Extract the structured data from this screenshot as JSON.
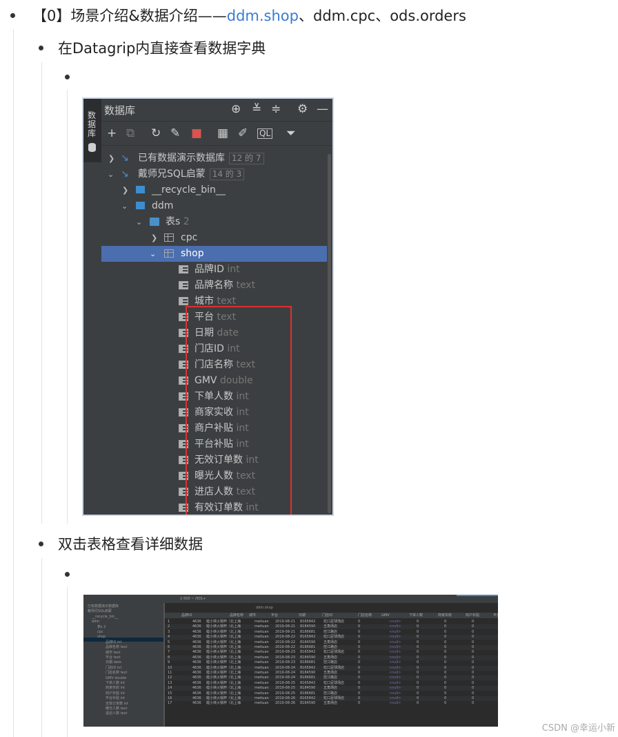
{
  "line1": {
    "prefix": "【0】场景介绍&数据介绍——",
    "link": "ddm.shop",
    "suffix": "、ddm.cpc、ods.orders"
  },
  "line2": "在Datagrip内直接查看数据字典",
  "line3": "双击表格查看详细数据",
  "watermark": "CSDN @幸运小新",
  "db_panel": {
    "side_tab": "数据库",
    "title": "数据库",
    "title_icons": [
      "crosshair-icon",
      "expand-all-icon",
      "collapse-all-icon",
      "gear-icon",
      "minimize-icon"
    ],
    "toolbar_icons": [
      "add-icon",
      "copy-icon",
      "refresh-icon",
      "edit-schema-icon",
      "stop-icon",
      "table-icon",
      "edit-icon",
      "sql-icon",
      "filter-icon"
    ],
    "tree": {
      "ds1": {
        "label": "已有数据演示数据库",
        "badge": "12 的 7"
      },
      "ds2": {
        "label": "戴师兄SQL启蒙",
        "badge": "14 的 3"
      },
      "recycle": "__recycle_bin__",
      "ddm": "ddm",
      "tables_folder": "表s",
      "tables_count": "2",
      "cpc": "cpc",
      "shop": "shop"
    },
    "columns": [
      {
        "name": "品牌ID",
        "type": "int"
      },
      {
        "name": "品牌名称",
        "type": "text"
      },
      {
        "name": "城市",
        "type": "text"
      },
      {
        "name": "平台",
        "type": "text"
      },
      {
        "name": "日期",
        "type": "date"
      },
      {
        "name": "门店ID",
        "type": "int"
      },
      {
        "name": "门店名称",
        "type": "text"
      },
      {
        "name": "GMV",
        "type": "double"
      },
      {
        "name": "下单人数",
        "type": "int"
      },
      {
        "name": "商家实收",
        "type": "int"
      },
      {
        "name": "商户补贴",
        "type": "int"
      },
      {
        "name": "平台补贴",
        "type": "int"
      },
      {
        "name": "无效订单数",
        "type": "int"
      },
      {
        "name": "曝光人数",
        "type": "text"
      },
      {
        "name": "进店人数",
        "type": "text"
      },
      {
        "name": "有效订单数",
        "type": "int"
      }
    ]
  },
  "grid_screenshot": {
    "toolbar_text": "1-500 ~ /501+",
    "tab_label": "ddm.shop",
    "left_tree": [
      "已有数据演示数据库",
      "戴师兄SQL启蒙",
      "__recycle_bin__",
      "ddm",
      "表s 2",
      "cpc",
      "shop",
      "品牌ID int",
      "品牌名称 text",
      "城市 text",
      "平台 text",
      "日期 date",
      "门店ID int",
      "门店名称 text",
      "GMV double",
      "下单人数 int",
      "商家实收 int",
      "商户补贴 int",
      "平台补贴 int",
      "无效订单数 int",
      "曝光人数 text",
      "进店人数 text"
    ],
    "headers": [
      "品牌ID",
      "品牌名称",
      "城市",
      "平台",
      "日期",
      "门店ID",
      "门店名称",
      "GMV",
      "下单人数",
      "商家实收",
      "商户补贴",
      "平台补贴"
    ],
    "rows": [
      [
        "1",
        "4636",
        "蛙小侠火锅杯（北上海",
        "meituan",
        "2019-08-21",
        "8165842",
        "虹口足球场店",
        "0",
        "<null>",
        "0",
        "0",
        "0"
      ],
      [
        "2",
        "4636",
        "蛙小侠火锅杯（北上海",
        "meituan",
        "2019-08-21",
        "8184590",
        "五角场店",
        "0",
        "<null>",
        "0",
        "0",
        "0"
      ],
      [
        "3",
        "4636",
        "蛙小侠火锅杯（北上海",
        "meituan",
        "2019-08-21",
        "8186681",
        "控江路店",
        "0",
        "<null>",
        "0",
        "0",
        "0"
      ],
      [
        "4",
        "4636",
        "蛙小侠火锅杯（北上海",
        "meituan",
        "2019-08-22",
        "8165842",
        "虹口足球场店",
        "0",
        "<null>",
        "0",
        "0",
        "0"
      ],
      [
        "5",
        "4636",
        "蛙小侠火锅杯（北上海",
        "meituan",
        "2019-08-22",
        "8184590",
        "五角场店",
        "0",
        "<null>",
        "0",
        "0",
        "0"
      ],
      [
        "6",
        "4636",
        "蛙小侠火锅杯（北上海",
        "meituan",
        "2019-08-22",
        "8186681",
        "控江路店",
        "0",
        "<null>",
        "0",
        "0",
        "0"
      ],
      [
        "7",
        "4636",
        "蛙小侠火锅杯（北上海",
        "meituan",
        "2019-08-23",
        "8165842",
        "虹口足球场店",
        "0",
        "<null>",
        "0",
        "0",
        "0"
      ],
      [
        "8",
        "4636",
        "蛙小侠火锅杯（北上海",
        "meituan",
        "2019-08-23",
        "8184590",
        "五角场店",
        "0",
        "<null>",
        "0",
        "0",
        "0"
      ],
      [
        "9",
        "4636",
        "蛙小侠火锅杯（北上海",
        "meituan",
        "2019-08-23",
        "8186681",
        "控江路店",
        "0",
        "<null>",
        "0",
        "0",
        "0"
      ],
      [
        "10",
        "4636",
        "蛙小侠火锅杯（北上海",
        "meituan",
        "2019-08-24",
        "8165842",
        "虹口足球场店",
        "0",
        "<null>",
        "0",
        "0",
        "0"
      ],
      [
        "11",
        "4636",
        "蛙小侠火锅杯（北上海",
        "meituan",
        "2019-08-24",
        "8184590",
        "五角场店",
        "0",
        "<null>",
        "0",
        "0",
        "0"
      ],
      [
        "12",
        "4636",
        "蛙小侠火锅杯（北上海",
        "meituan",
        "2019-08-24",
        "8186681",
        "控江路店",
        "0",
        "<null>",
        "0",
        "0",
        "0"
      ],
      [
        "13",
        "4636",
        "蛙小侠火锅杯（北上海",
        "meituan",
        "2019-08-25",
        "8165842",
        "虹口足球场店",
        "0",
        "<null>",
        "0",
        "0",
        "0"
      ],
      [
        "14",
        "4636",
        "蛙小侠火锅杯（北上海",
        "meituan",
        "2019-08-25",
        "8184590",
        "五角场店",
        "0",
        "<null>",
        "0",
        "0",
        "0"
      ],
      [
        "15",
        "4636",
        "蛙小侠火锅杯（北上海",
        "meituan",
        "2019-08-25",
        "8186681",
        "控江路店",
        "0",
        "<null>",
        "0",
        "0",
        "0"
      ],
      [
        "16",
        "4636",
        "蛙小侠火锅杯（北上海",
        "meituan",
        "2019-08-26",
        "8165842",
        "虹口足球场店",
        "0",
        "<null>",
        "0",
        "0",
        "0"
      ],
      [
        "17",
        "4636",
        "蛙小侠火锅杯（北上海",
        "meituan",
        "2019-08-26",
        "8184590",
        "五角场店",
        "0",
        "<null>",
        "0",
        "0",
        "0"
      ]
    ]
  }
}
